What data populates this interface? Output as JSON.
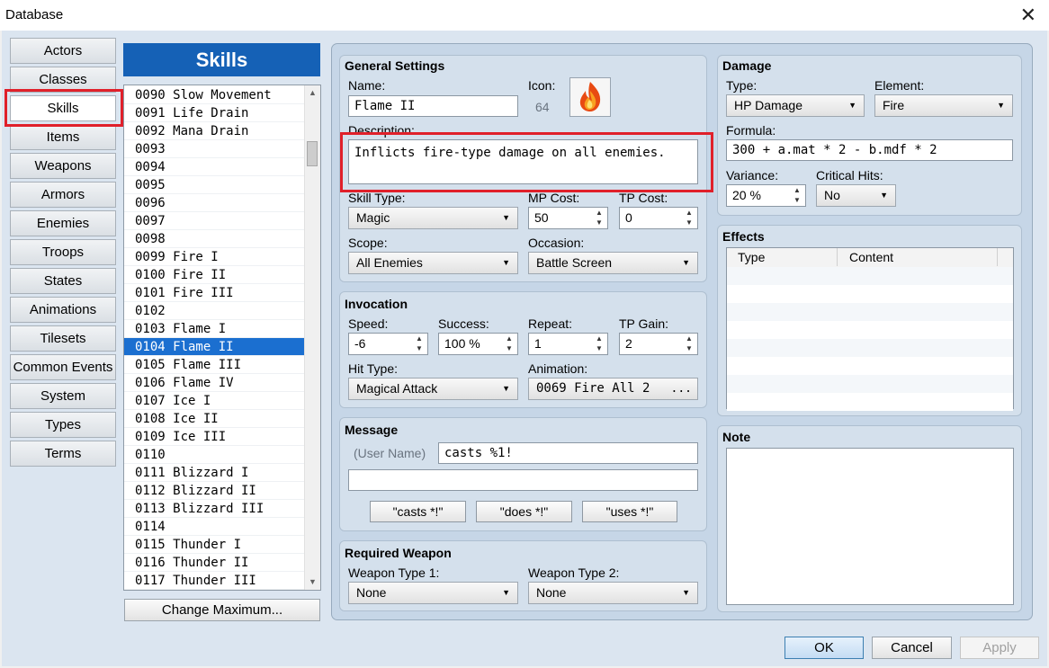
{
  "window": {
    "title": "Database",
    "close_glyph": "✕"
  },
  "tabs": [
    "Actors",
    "Classes",
    "Skills",
    "Items",
    "Weapons",
    "Armors",
    "Enemies",
    "Troops",
    "States",
    "Animations",
    "Tilesets",
    "Common Events",
    "System",
    "Types",
    "Terms"
  ],
  "selected_tab": "Skills",
  "list": {
    "header": "Skills",
    "rows": [
      "0090 Slow Movement",
      "0091 Life Drain",
      "0092 Mana Drain",
      "0093",
      "0094",
      "0095",
      "0096",
      "0097",
      "0098",
      "0099 Fire I",
      "0100 Fire II",
      "0101 Fire III",
      "0102",
      "0103 Flame I",
      "0104 Flame II",
      "0105 Flame III",
      "0106 Flame IV",
      "0107 Ice I",
      "0108 Ice II",
      "0109 Ice III",
      "0110",
      "0111 Blizzard I",
      "0112 Blizzard II",
      "0113 Blizzard III",
      "0114",
      "0115 Thunder I",
      "0116 Thunder II",
      "0117 Thunder III"
    ],
    "selected": "0104 Flame II",
    "change_max_label": "Change Maximum..."
  },
  "general": {
    "title": "General Settings",
    "name_label": "Name:",
    "name_value": "Flame II",
    "icon_label": "Icon:",
    "icon_index": "64",
    "icon_name": "fire-icon",
    "desc_label": "Description:",
    "desc_value": "Inflicts fire-type damage on all enemies.",
    "skill_type_label": "Skill Type:",
    "skill_type_value": "Magic",
    "mp_label": "MP Cost:",
    "mp_value": "50",
    "tp_label": "TP Cost:",
    "tp_value": "0",
    "scope_label": "Scope:",
    "scope_value": "All Enemies",
    "occasion_label": "Occasion:",
    "occasion_value": "Battle Screen"
  },
  "invocation": {
    "title": "Invocation",
    "speed_label": "Speed:",
    "speed_value": "-6",
    "success_label": "Success:",
    "success_value": "100 %",
    "repeat_label": "Repeat:",
    "repeat_value": "1",
    "tpgain_label": "TP Gain:",
    "tpgain_value": "2",
    "hit_type_label": "Hit Type:",
    "hit_type_value": "Magical Attack",
    "animation_label": "Animation:",
    "animation_value": "0069 Fire All 2",
    "animation_btn": "..."
  },
  "message": {
    "title": "Message",
    "user_name": "(User Name)",
    "line1": "casts %1!",
    "line2": "",
    "btn_casts": "\"casts *!\"",
    "btn_does": "\"does *!\"",
    "btn_uses": "\"uses *!\""
  },
  "required_weapon": {
    "title": "Required Weapon",
    "type1_label": "Weapon Type 1:",
    "type1_value": "None",
    "type2_label": "Weapon Type 2:",
    "type2_value": "None"
  },
  "damage": {
    "title": "Damage",
    "type_label": "Type:",
    "type_value": "HP Damage",
    "element_label": "Element:",
    "element_value": "Fire",
    "formula_label": "Formula:",
    "formula_value": "300 + a.mat * 2 - b.mdf * 2",
    "variance_label": "Variance:",
    "variance_value": "20 %",
    "crit_label": "Critical Hits:",
    "crit_value": "No"
  },
  "effects": {
    "title": "Effects",
    "col_type": "Type",
    "col_content": "Content"
  },
  "note": {
    "title": "Note",
    "value": ""
  },
  "buttons": {
    "ok": "OK",
    "cancel": "Cancel",
    "apply": "Apply"
  },
  "colors": {
    "accent_blue": "#1561b6",
    "highlight_red": "#e0202a",
    "selection": "#1b6fd0"
  }
}
